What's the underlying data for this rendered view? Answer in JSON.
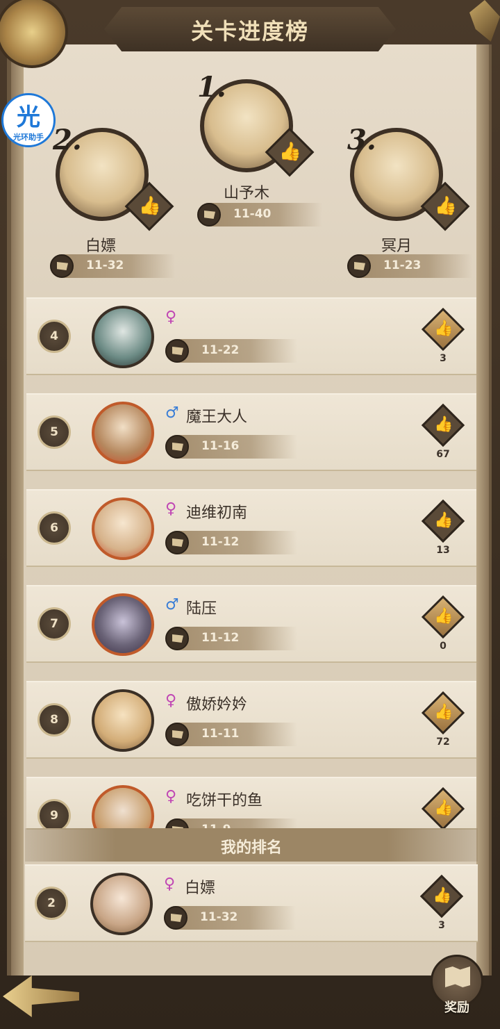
{
  "title": "关卡进度榜",
  "assistant_badge": {
    "char": "光",
    "label": "光环助手"
  },
  "podium": [
    {
      "rank": "1.",
      "name": "山予木",
      "stage": "11-40"
    },
    {
      "rank": "2.",
      "name": "白嫖",
      "stage": "11-32"
    },
    {
      "rank": "3.",
      "name": "冥月",
      "stage": "11-23"
    }
  ],
  "rows": [
    {
      "rank": "4",
      "gender": "♀",
      "name": "",
      "stage": "11-22",
      "likes": "3"
    },
    {
      "rank": "5",
      "gender": "♂",
      "name": "魔王大人",
      "stage": "11-16",
      "likes": "67"
    },
    {
      "rank": "6",
      "gender": "♀",
      "name": "迪维初南",
      "stage": "11-12",
      "likes": "13"
    },
    {
      "rank": "7",
      "gender": "♂",
      "name": "陆压",
      "stage": "11-12",
      "likes": "0"
    },
    {
      "rank": "8",
      "gender": "♀",
      "name": "傲娇妗妗",
      "stage": "11-11",
      "likes": "72"
    },
    {
      "rank": "9",
      "gender": "♀",
      "name": "吃饼干的鱼",
      "stage": "11-9",
      "likes": ""
    }
  ],
  "my_rank": {
    "header": "我的排名",
    "rank": "2",
    "gender": "♀",
    "name": "白嫖",
    "stage": "11-32",
    "likes": "3"
  },
  "reward_label": "奖励",
  "icons": {
    "like": "thumbs-up-icon",
    "flag": "flag-icon",
    "back": "back-arrow-icon",
    "reward": "map-scroll-icon"
  },
  "colors": {
    "female": "#c046b4",
    "male": "#3a7ed6",
    "like_gold": "#c79a52",
    "like_dark": "#5a4a38"
  }
}
